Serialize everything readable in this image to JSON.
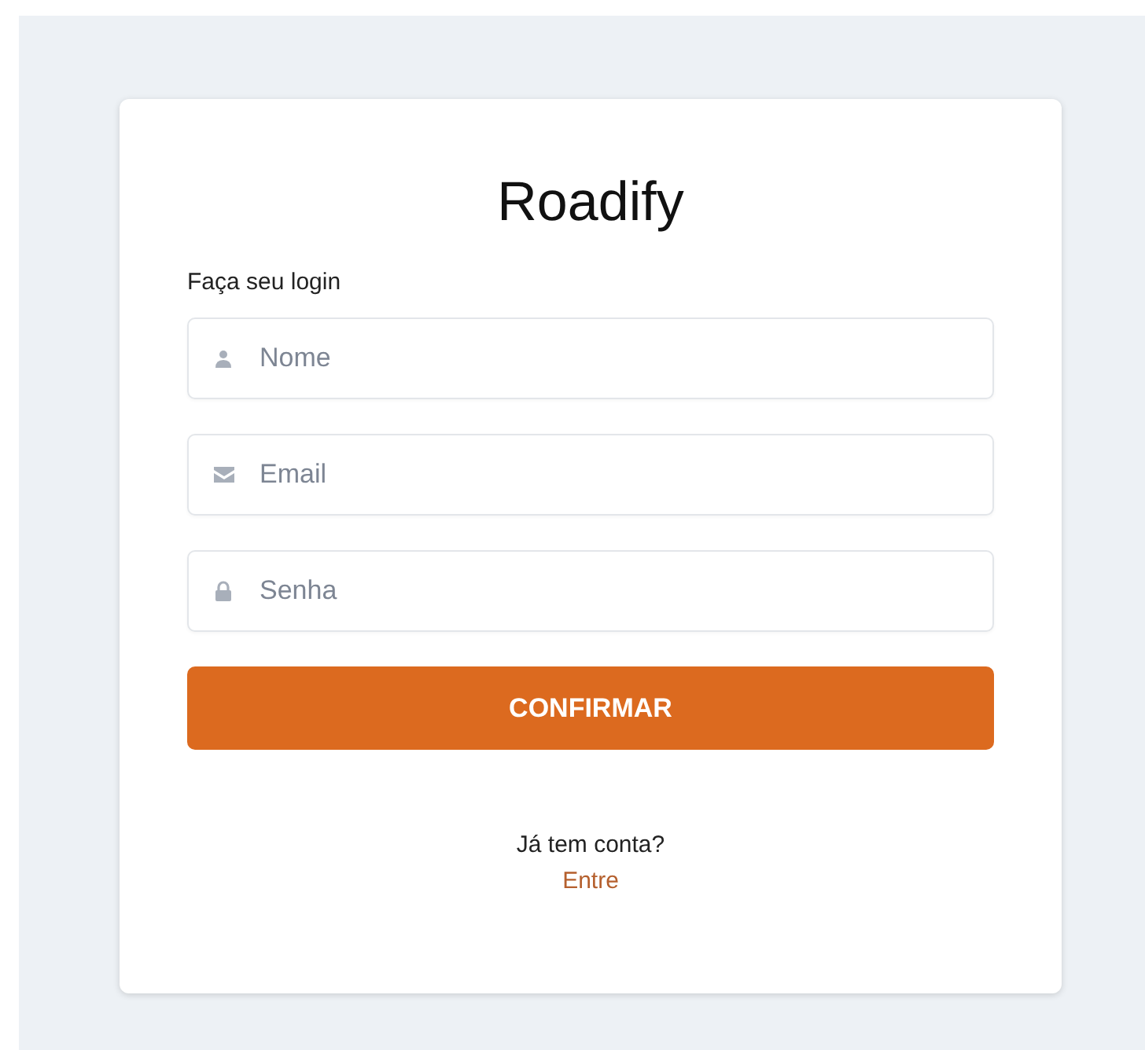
{
  "title": "Roadify",
  "subtitle": "Faça seu login",
  "fields": [
    {
      "kind": "name",
      "placeholder": "Nome"
    },
    {
      "kind": "email",
      "placeholder": "Email"
    },
    {
      "kind": "password",
      "placeholder": "Senha"
    }
  ],
  "submit": "CONFIRMAR",
  "footer": {
    "question": "Já tem conta?",
    "link": "Entre"
  }
}
